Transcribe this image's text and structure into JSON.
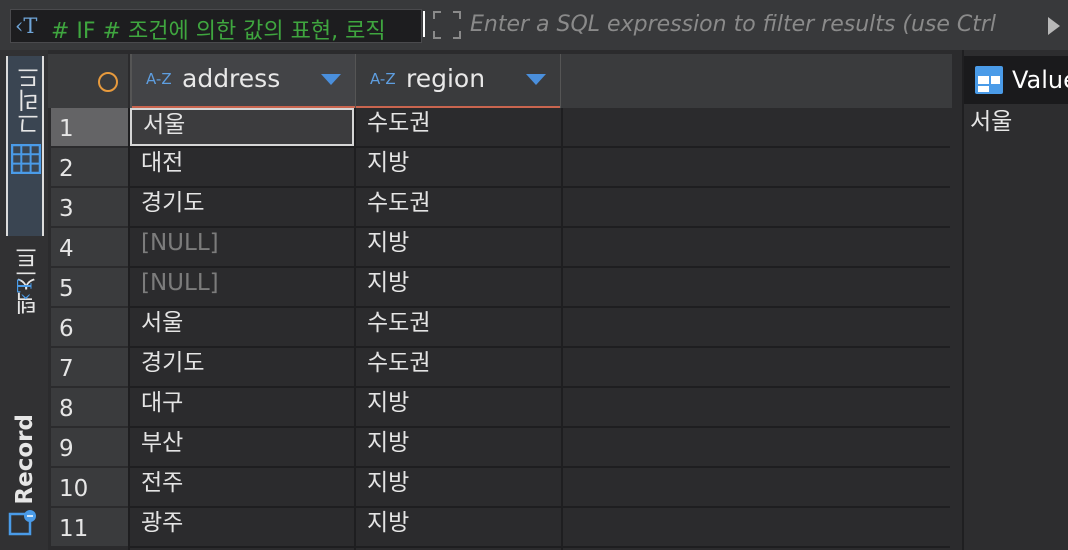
{
  "filter": {
    "sql_text": "# IF # 조건에 의한 값의 표현, 로직",
    "placeholder": "Enter a SQL expression to filter results (use Ctrl"
  },
  "tabs": {
    "grid_label": "그리드",
    "text_label": "텍스트",
    "record_label": "Record"
  },
  "columns": [
    {
      "type_badge": "A-Z",
      "name": "address"
    },
    {
      "type_badge": "A-Z",
      "name": "region"
    }
  ],
  "rows": [
    {
      "num": "1",
      "address": "서울",
      "region": "수도권"
    },
    {
      "num": "2",
      "address": "대전",
      "region": "지방"
    },
    {
      "num": "3",
      "address": "경기도",
      "region": "수도권"
    },
    {
      "num": "4",
      "address": "[NULL]",
      "region": "지방"
    },
    {
      "num": "5",
      "address": "[NULL]",
      "region": "지방"
    },
    {
      "num": "6",
      "address": "서울",
      "region": "수도권"
    },
    {
      "num": "7",
      "address": "경기도",
      "region": "수도권"
    },
    {
      "num": "8",
      "address": "대구",
      "region": "지방"
    },
    {
      "num": "9",
      "address": "부산",
      "region": "지방"
    },
    {
      "num": "10",
      "address": "전주",
      "region": "지방"
    },
    {
      "num": "11",
      "address": "광주",
      "region": "지방"
    }
  ],
  "value_panel": {
    "title": "Value",
    "value": "서울"
  },
  "colors": {
    "accent": "#4a8fdc",
    "sql_text": "#3fa63f",
    "null_text": "#7c7c7c",
    "header_underline": "#c9654f"
  }
}
